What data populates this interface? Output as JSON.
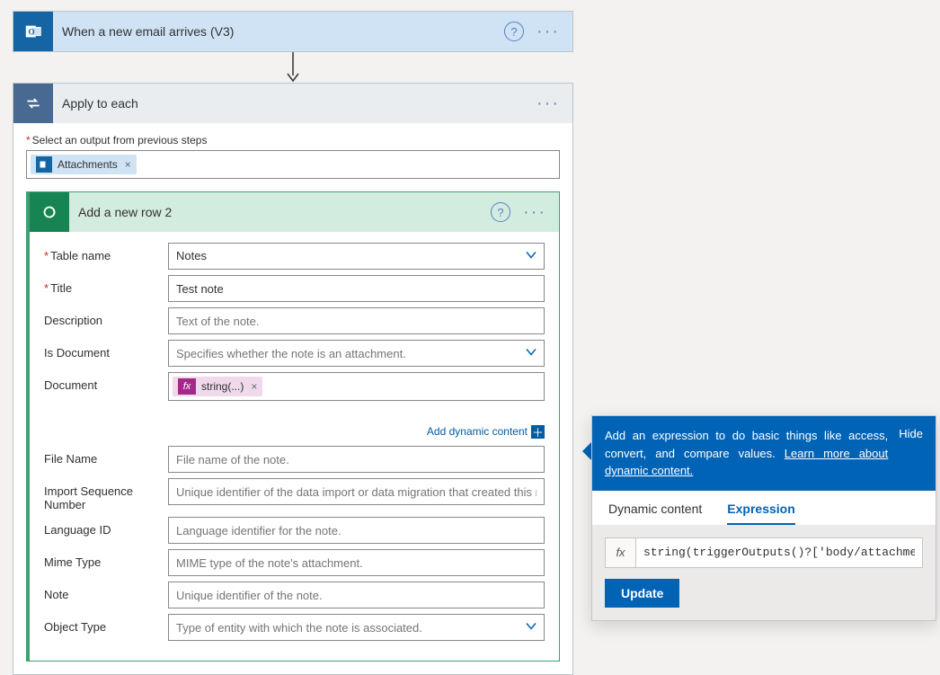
{
  "trigger": {
    "title": "When a new email arrives (V3)"
  },
  "loop": {
    "title": "Apply to each",
    "output_label": "Select an output from previous steps",
    "token": "Attachments"
  },
  "action": {
    "title": "Add a new row 2",
    "table_name_label": "Table name",
    "table_name_value": "Notes",
    "title_label": "Title",
    "title_value": "Test note",
    "desc_label": "Description",
    "desc_ph": "Text of the note.",
    "isdoc_label": "Is Document",
    "isdoc_ph": "Specifies whether the note is an attachment.",
    "doc_label": "Document",
    "doc_token": "string(...)",
    "dyn_label": "Add dynamic content",
    "fname_label": "File Name",
    "fname_ph": "File name of the note.",
    "iseq_label": "Import Sequence Number",
    "iseq_ph": "Unique identifier of the data import or data migration that created this record.",
    "lang_label": "Language ID",
    "lang_ph": "Language identifier for the note.",
    "mime_label": "Mime Type",
    "mime_ph": "MIME type of the note's attachment.",
    "note_label": "Note",
    "note_ph": "Unique identifier of the note.",
    "objtype_label": "Object Type",
    "objtype_ph": "Type of entity with which the note is associated."
  },
  "expr": {
    "banner": "Add an expression to do basic things like access, convert, and compare values.",
    "learn": "Learn more about dynamic content.",
    "hide": "Hide",
    "tab_dc": "Dynamic content",
    "tab_ex": "Expression",
    "fx_label": "fx",
    "value": "string(triggerOutputs()?['body/attachments",
    "update": "Update"
  }
}
